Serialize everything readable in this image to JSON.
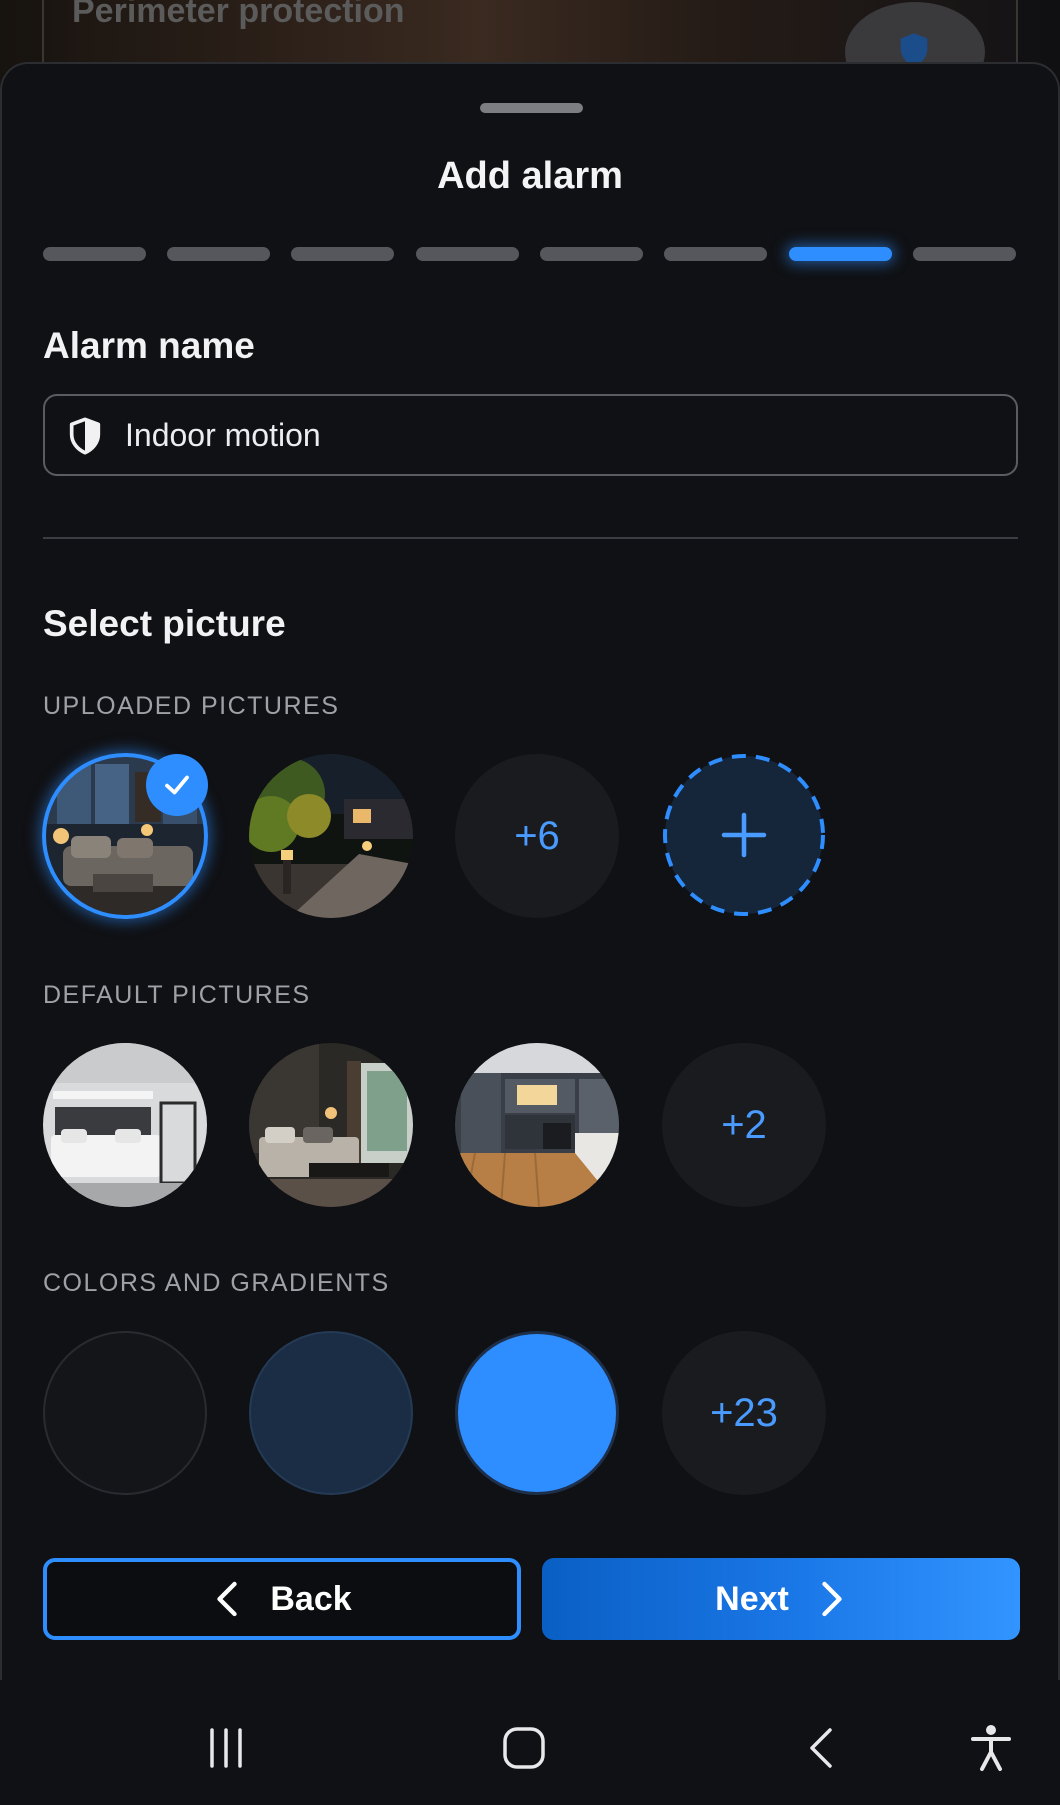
{
  "background": {
    "title": "Perimeter protection",
    "badge_icon": "shield-icon"
  },
  "sheet": {
    "title": "Add alarm",
    "progress": {
      "total_steps": 8,
      "current_step": 7
    }
  },
  "alarm_name": {
    "heading": "Alarm name",
    "icon": "shield-half-icon",
    "value": "Indoor motion"
  },
  "picture": {
    "heading": "Select picture",
    "uploaded": {
      "label": "UPLOADED PICTURES",
      "items": [
        {
          "kind": "photo",
          "subject": "living room at night",
          "selected": true
        },
        {
          "kind": "photo",
          "subject": "garden path with lamps",
          "selected": false
        }
      ],
      "more": "+6",
      "add_icon": "plus-icon"
    },
    "default": {
      "label": "DEFAULT PICTURES",
      "items": [
        {
          "kind": "photo",
          "subject": "white bedroom"
        },
        {
          "kind": "photo",
          "subject": "dark bedroom"
        },
        {
          "kind": "photo",
          "subject": "kitchen"
        }
      ],
      "more": "+2"
    },
    "colors": {
      "label": "COLORS AND GRADIENTS",
      "items": [
        "#141519",
        "#1a2d45",
        "#2e8dff"
      ],
      "more": "+23"
    }
  },
  "buttons": {
    "back": "Back",
    "next": "Next"
  },
  "colors": {
    "accent": "#2e8dff",
    "sheet_bg": "#101114"
  },
  "navbar": {
    "icons": [
      "recent-apps-icon",
      "home-icon",
      "back-icon",
      "accessibility-icon"
    ]
  }
}
